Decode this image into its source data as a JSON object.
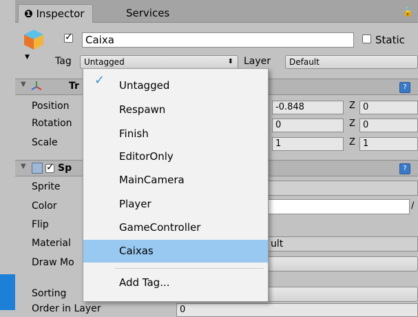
{
  "tabs": [
    {
      "label": "Inspector",
      "icon": "info-icon"
    },
    {
      "label": "Services"
    }
  ],
  "object": {
    "name": "Caixa",
    "static_label": "Static",
    "active": true
  },
  "tag": {
    "label": "Tag",
    "value": "Untagged"
  },
  "layer": {
    "label": "Layer",
    "value": "Default"
  },
  "transform": {
    "title": "Tr",
    "rows": [
      {
        "label": "Position",
        "y": "-0.848",
        "z_label": "Z",
        "z": "0"
      },
      {
        "label": "Rotation",
        "y": "0",
        "z_label": "Z",
        "z": "0"
      },
      {
        "label": "Scale",
        "y": "1",
        "z_label": "Z",
        "z": "1"
      }
    ]
  },
  "sprite_renderer": {
    "title": "Sp",
    "enabled": true,
    "props": [
      "Sprite",
      "Color",
      "Flip",
      "Material",
      "Draw Mo",
      "Sorting"
    ],
    "material_suffix": "ult",
    "order_label": "Order in Layer",
    "order_value": "0"
  },
  "tag_menu": {
    "items": [
      "Untagged",
      "Respawn",
      "Finish",
      "EditorOnly",
      "MainCamera",
      "Player",
      "GameController",
      "Caixas"
    ],
    "checked_index": 0,
    "highlighted_index": 7,
    "add_label": "Add Tag..."
  },
  "colors": {
    "accent": "#1c7fd8",
    "highlight": "#99c9f1",
    "panel": "#c2c2c2"
  }
}
